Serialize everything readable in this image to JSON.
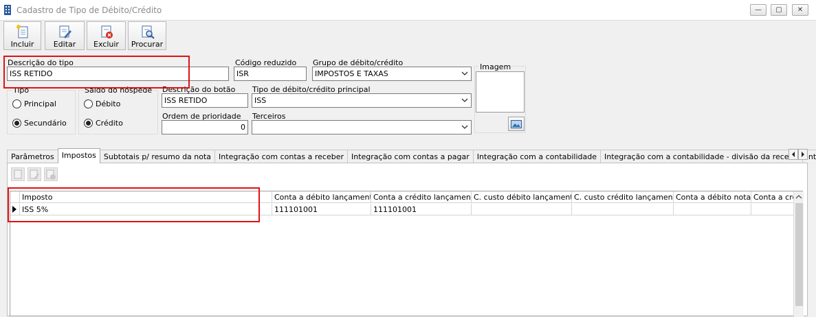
{
  "window": {
    "title": "Cadastro de Tipo de Débito/Crédito",
    "minimize_glyph": "—",
    "maximize_glyph": "▢",
    "close_glyph": "✕"
  },
  "toolbar": {
    "incluir": "Incluir",
    "editar": "Editar",
    "excluir": "Excluir",
    "procurar": "Procurar"
  },
  "form": {
    "descricao_label": "Descrição do tipo",
    "descricao_value": "ISS RETIDO",
    "codigo_label": "Código reduzido",
    "codigo_value": "ISR",
    "grupo_label": "Grupo de débito/crédito",
    "grupo_value": "IMPOSTOS E TAXAS",
    "imagem_label": "Imagem",
    "tipo_label": "Tipo",
    "tipo_principal": "Principal",
    "tipo_secundario": "Secundário",
    "tipo_selected": "Secundário",
    "saldo_label": "Saldo do hóspede",
    "saldo_debito": "Débito",
    "saldo_credito": "Crédito",
    "saldo_selected": "Crédito",
    "botao_label": "Descrição do botão",
    "botao_value": "ISS RETIDO",
    "tipo_principal_label": "Tipo de débito/crédito principal",
    "tipo_principal_value": "ISS",
    "ordem_label": "Ordem de prioridade",
    "ordem_value": "0",
    "terceiros_label": "Terceiros",
    "terceiros_value": ""
  },
  "tabs": [
    {
      "label": "Parâmetros"
    },
    {
      "label": "Impostos",
      "active": true
    },
    {
      "label": "Subtotais p/ resumo da nota"
    },
    {
      "label": "Integração com contas a receber"
    },
    {
      "label": "Integração com contas a pagar"
    },
    {
      "label": "Integração com a contabilidade"
    },
    {
      "label": "Integração com a contabilidade - divisão da receita"
    },
    {
      "label": "Integraçã"
    }
  ],
  "grid": {
    "columns": [
      "Imposto",
      "Conta a débito lançamento",
      "Conta a crédito lançamento",
      "C. custo débito lançamento",
      "C. custo crédito lançamento",
      "Conta a débito nota",
      "Conta a cré"
    ],
    "rows": [
      [
        "ISS 5%",
        "111101001",
        "111101001",
        "",
        "",
        "",
        ""
      ]
    ]
  },
  "colors": {
    "highlight": "#e01010",
    "window_bg": "#f0f0f0"
  },
  "icons": [
    "app-icon",
    "incluir-icon",
    "editar-icon",
    "excluir-icon",
    "procurar-icon",
    "image-picker-icon",
    "dropdown-arrow-icon",
    "row-pointer-icon",
    "scroll-left-icon",
    "scroll-right-icon",
    "scroll-up-icon"
  ]
}
